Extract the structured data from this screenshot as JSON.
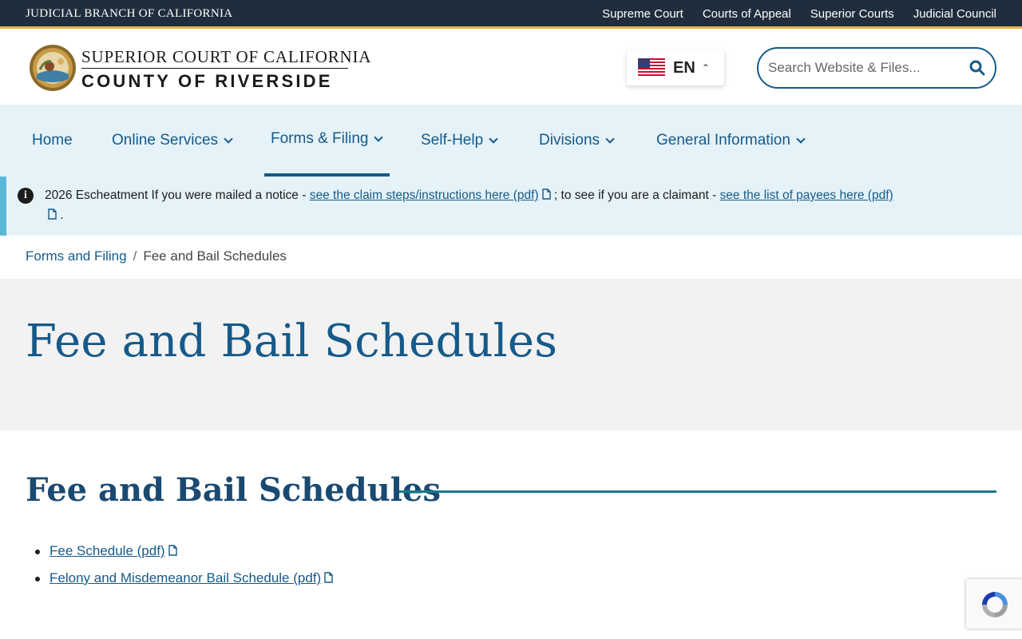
{
  "topbar": {
    "brand": "JUDICIAL BRANCH OF CALIFORNIA",
    "links": [
      "Supreme Court",
      "Courts of Appeal",
      "Superior Courts",
      "Judicial Council"
    ]
  },
  "header": {
    "logo_line1": "SUPERIOR COURT OF CALIFORNIA",
    "logo_line2": "COUNTY OF RIVERSIDE",
    "language": {
      "code": "EN",
      "flag_icon": "us-flag-icon"
    },
    "search": {
      "placeholder": "Search Website & Files...",
      "value": ""
    }
  },
  "nav": {
    "items": [
      {
        "label": "Home",
        "has_dropdown": false
      },
      {
        "label": "Online Services",
        "has_dropdown": true
      },
      {
        "label": "Forms & Filing",
        "has_dropdown": true,
        "active": true
      },
      {
        "label": "Self-Help",
        "has_dropdown": true
      },
      {
        "label": "Divisions",
        "has_dropdown": true
      },
      {
        "label": "General Information",
        "has_dropdown": true
      }
    ]
  },
  "alert": {
    "prefix": "2026 Escheatment If you were mailed a notice - ",
    "link1": "see the claim steps/instructions here (pdf)",
    "middle": "; to see if you are a claimant - ",
    "link2": "see the list of payees here (pdf)",
    "suffix": "."
  },
  "breadcrumb": {
    "parent": "Forms and Filing",
    "separator": "/",
    "current": "Fee and Bail Schedules"
  },
  "page_title": "Fee and Bail Schedules",
  "section": {
    "title": "Fee and Bail Schedules",
    "documents": [
      "Fee Schedule (pdf)",
      "Felony and Misdemeanor Bail Schedule (pdf)"
    ]
  },
  "colors": {
    "topbar_bg": "#1f2d3d",
    "topbar_accent": "#e8b54a",
    "brand_blue": "#155a8a",
    "nav_bg": "#e5f2f8",
    "alert_border": "#5bb7d6",
    "hero_bg": "#f2f2f2",
    "section_rule": "#177a8c"
  }
}
